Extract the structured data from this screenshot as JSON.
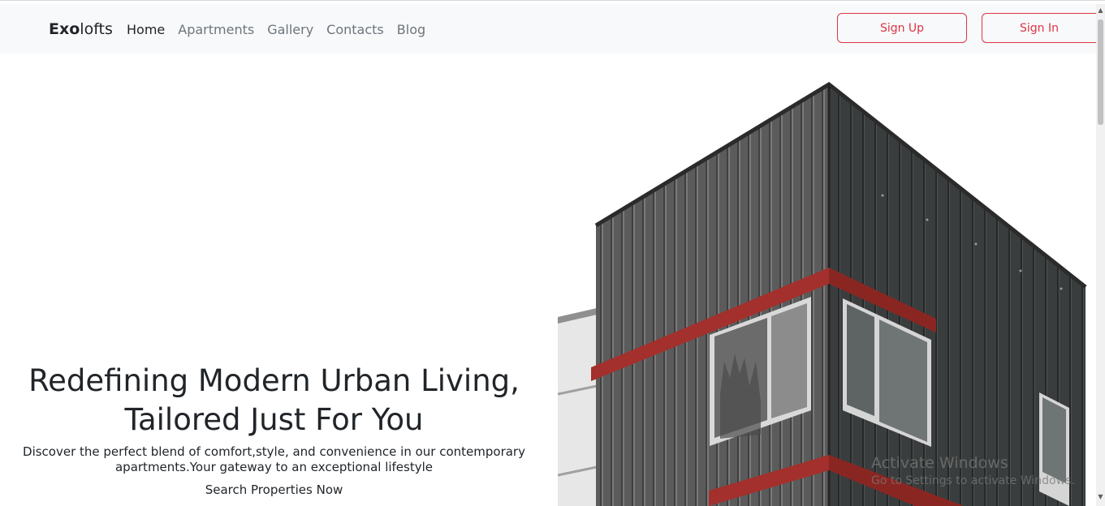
{
  "navbar": {
    "brand_bold": "Exo",
    "brand_rest": "lofts",
    "links": [
      {
        "label": "Home"
      },
      {
        "label": "Apartments"
      },
      {
        "label": "Gallery"
      },
      {
        "label": "Contacts"
      },
      {
        "label": "Blog"
      }
    ],
    "signup_label": "Sign Up",
    "signin_label": "Sign In",
    "accent_color": "#dc3545"
  },
  "hero": {
    "title_line1": "Redefining Modern Urban Living,",
    "title_line2": "Tailored Just For You",
    "subtitle_line1": "Discover the perfect blend of comfort,style, and convenience in our contemporary",
    "subtitle_line2": "apartments.Your gateway to an exceptional lifestyle",
    "cta": "Search Properties Now"
  },
  "watermark": {
    "title": "Activate Windows",
    "subtitle": "Go to Settings to activate Windows."
  }
}
